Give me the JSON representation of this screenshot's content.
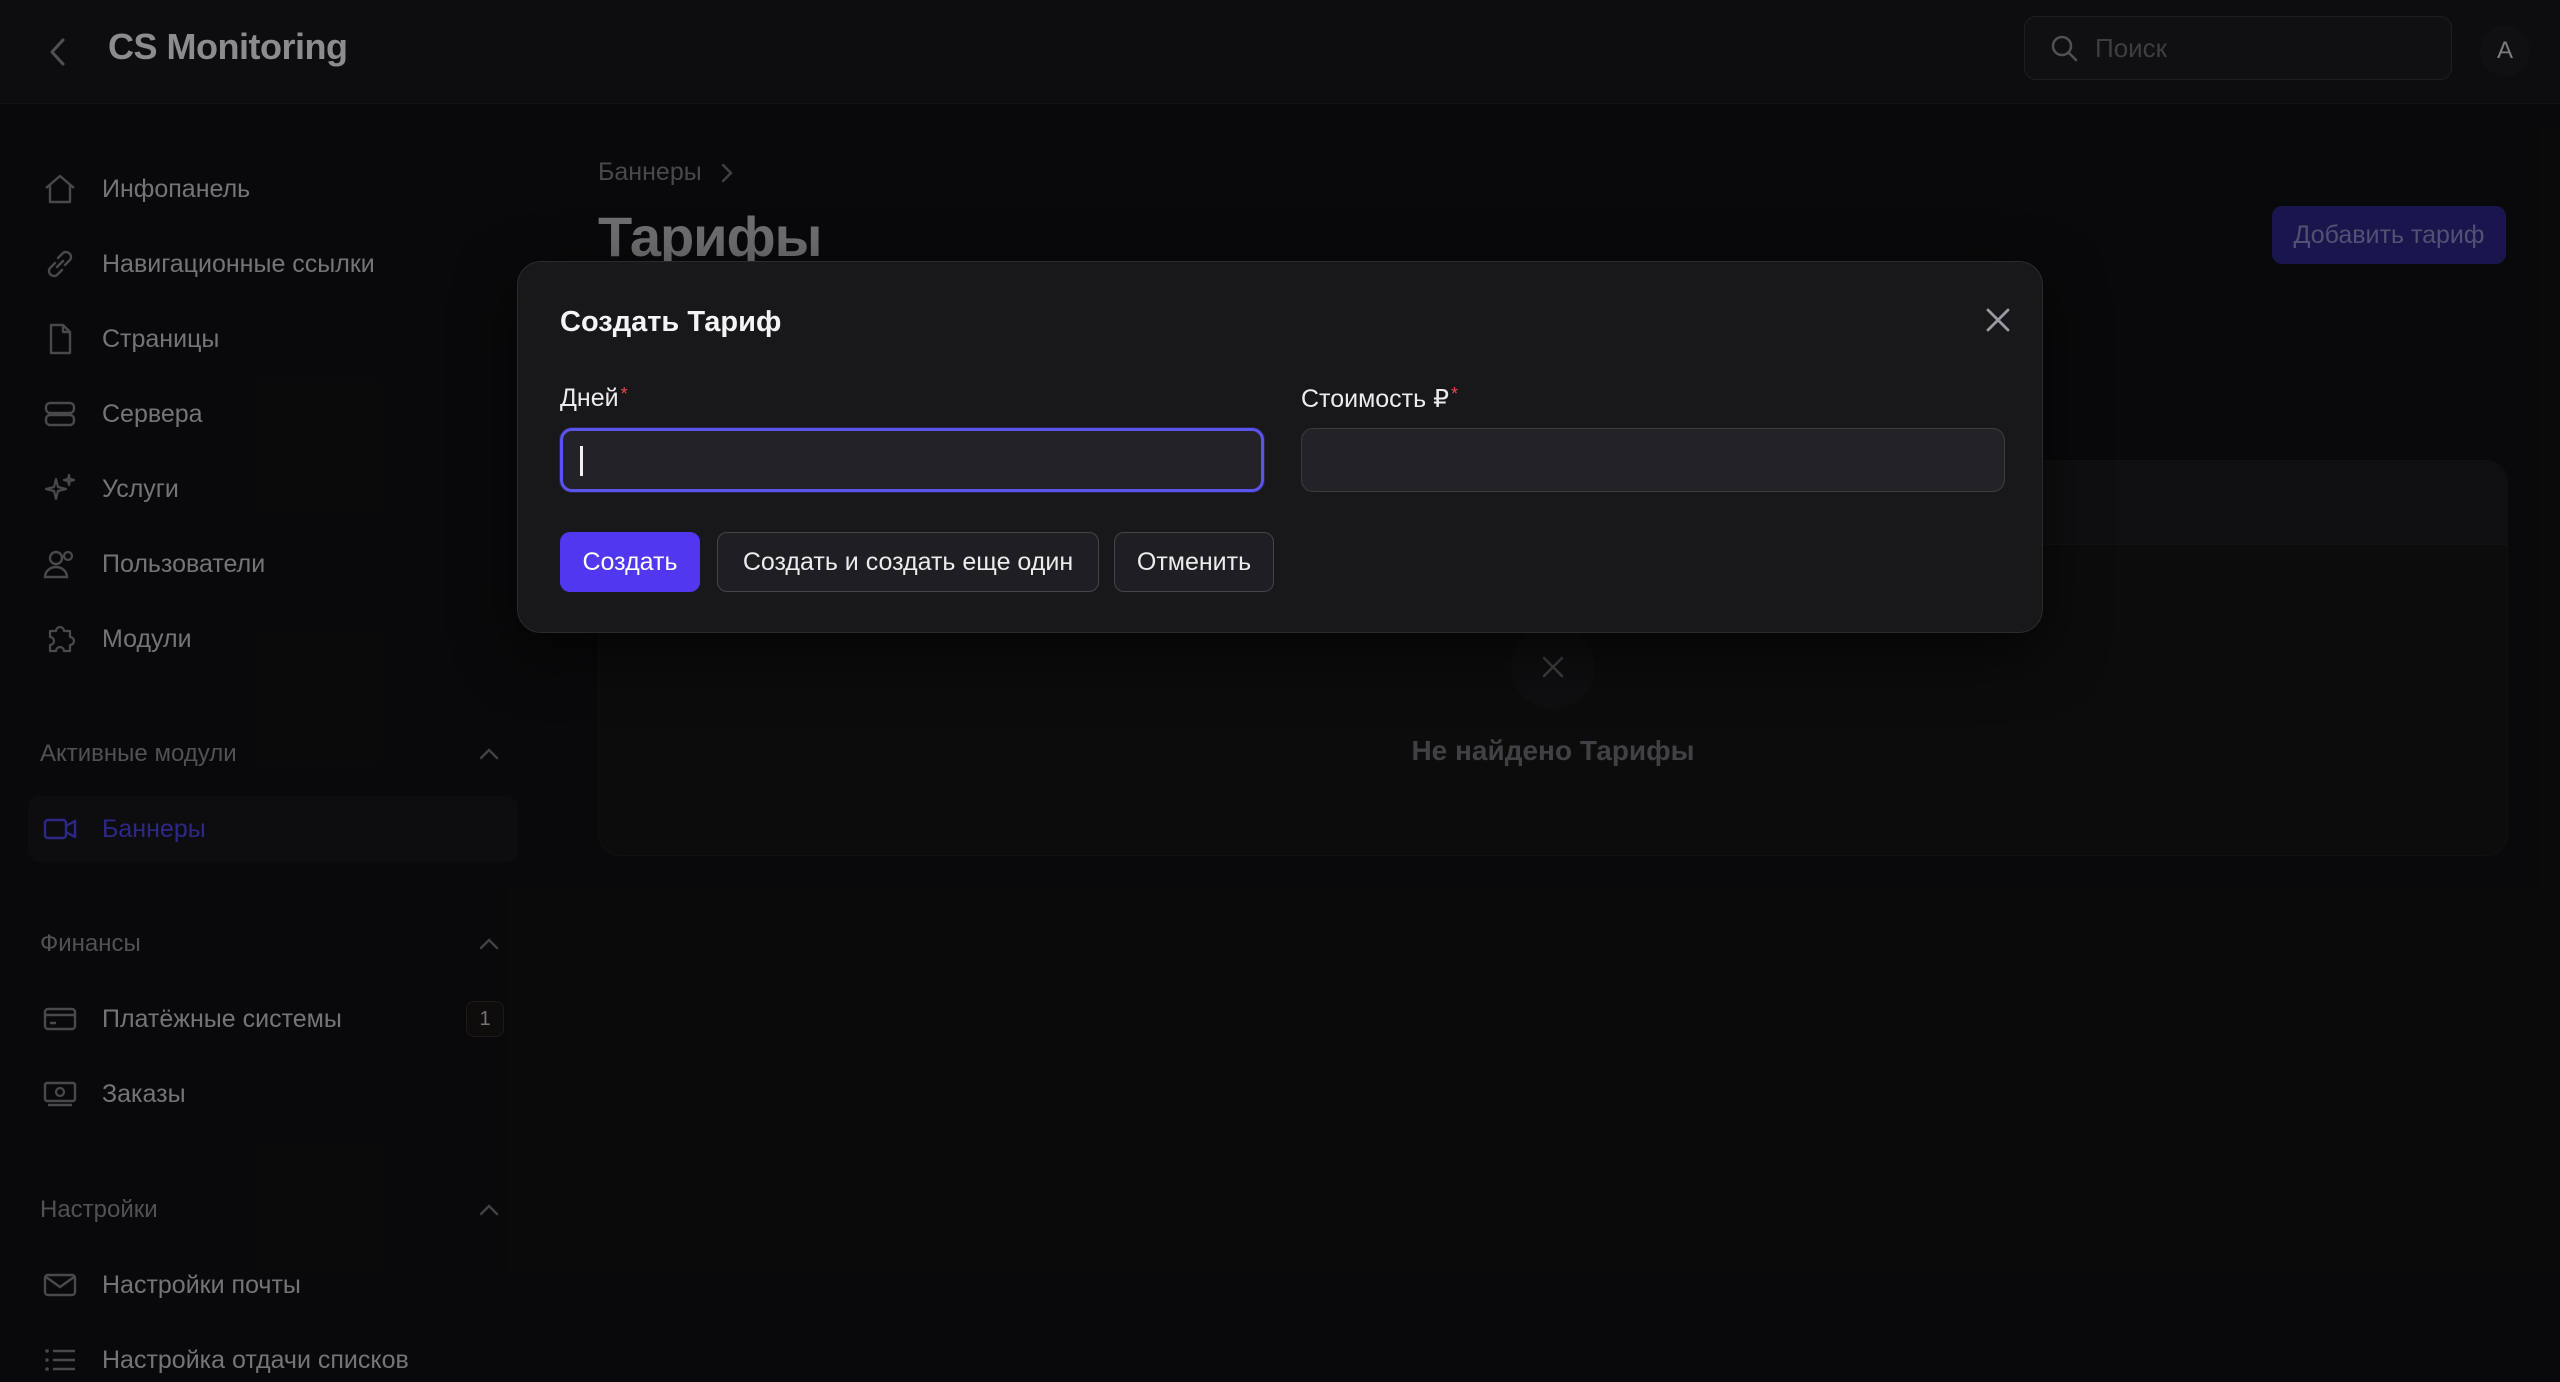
{
  "header": {
    "app_title": "CS Monitoring",
    "search_placeholder": "Поиск",
    "avatar_letter": "A"
  },
  "sidebar": {
    "items": [
      {
        "label": "Инфопанель",
        "icon": "home-icon"
      },
      {
        "label": "Навигационные ссылки",
        "icon": "link-icon"
      },
      {
        "label": "Страницы",
        "icon": "document-icon"
      },
      {
        "label": "Сервера",
        "icon": "server-icon"
      },
      {
        "label": "Услуги",
        "icon": "sparkles-icon"
      },
      {
        "label": "Пользователи",
        "icon": "users-icon"
      },
      {
        "label": "Модули",
        "icon": "puzzle-icon"
      }
    ],
    "sections": [
      {
        "title": "Активные модули",
        "items": [
          {
            "label": "Баннеры",
            "icon": "video-camera-icon",
            "active": true
          }
        ]
      },
      {
        "title": "Финансы",
        "items": [
          {
            "label": "Платёжные системы",
            "icon": "credit-card-icon",
            "badge": "1"
          },
          {
            "label": "Заказы",
            "icon": "cash-icon"
          }
        ]
      },
      {
        "title": "Настройки",
        "items": [
          {
            "label": "Настройки почты",
            "icon": "envelope-icon"
          },
          {
            "label": "Настройка отдачи списков",
            "icon": "list-icon"
          }
        ]
      }
    ]
  },
  "main": {
    "breadcrumb": [
      "Баннеры"
    ],
    "page_title": "Тарифы",
    "add_button": "Добавить тариф",
    "empty_text": "Не найдено Тарифы"
  },
  "modal": {
    "title": "Создать Тариф",
    "fields": [
      {
        "label": "Дней",
        "required": "*",
        "value": ""
      },
      {
        "label": "Стоимость ₽",
        "required": "*",
        "value": ""
      }
    ],
    "buttons": {
      "create": "Создать",
      "create_another": "Создать и создать еще один",
      "cancel": "Отменить"
    }
  },
  "colors": {
    "accent": "#4f38ef",
    "focus_ring": "#5b53ee",
    "required": "#e5484d",
    "background": "#111113",
    "surface": "#18181b"
  }
}
